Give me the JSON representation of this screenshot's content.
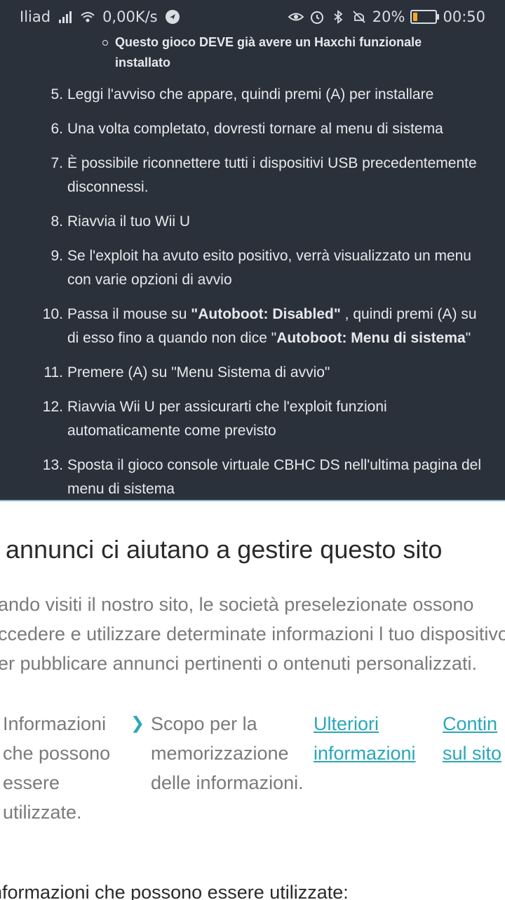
{
  "status_bar": {
    "carrier": "Iliad",
    "speed": "0,00K/s",
    "battery": "20%",
    "time": "00:50",
    "icons": [
      "signal-icon",
      "wifi-icon",
      "vpn-icon",
      "eye-icon",
      "alarm-icon",
      "bluetooth-icon",
      "mute-icon",
      "battery-icon"
    ]
  },
  "article": {
    "sub_bullet": "Questo gioco DEVE già avere un Haxchi funzionale installato",
    "steps": [
      {
        "num": "5.",
        "text": "Leggi l'avviso che appare, quindi premi (A) per installare"
      },
      {
        "num": "6.",
        "text": "Una volta completato, dovresti tornare al menu di sistema"
      },
      {
        "num": "7.",
        "text": "È possibile riconnettere tutti i dispositivi USB precedentemente disconnessi."
      },
      {
        "num": "8.",
        "text": "Riavvia il tuo Wii U"
      },
      {
        "num": "9.",
        "text": "Se l'exploit ha avuto esito positivo, verrà visualizzato un menu con varie opzioni di avvio"
      },
      {
        "num": "10.",
        "pre": "Passa il mouse su ",
        "b1": "\"Autoboot: Disabled\"",
        "mid": " , quindi premi (A) su di esso fino a quando non dice \"",
        "b2": "Autoboot: Menu di sistema",
        "post": "\""
      },
      {
        "num": "11.",
        "text": "Premere (A) su \"Menu Sistema di avvio\""
      },
      {
        "num": "12.",
        "text": "Riavvia Wii U per assicurarti che l'exploit funzioni automaticamente come previsto"
      },
      {
        "num": "13.",
        "text": "Sposta il gioco console virtuale CBHC DS nell'ultima pagina del menu di sistema"
      }
    ]
  },
  "consent": {
    "title": "I annunci ci aiutano a gestire questo sito",
    "description": "uando visiti il nostro sito, le società preselezionate ossono accedere e utilizzare determinate informazioni l tuo dispositivo per pubblicare annunci pertinenti o ontenuti personalizzati.",
    "col1": "Informazioni che possono essere utilizzate.",
    "col2": "Scopo per la memorizzazione delle informazioni.",
    "link_more": "Ulteriori informazioni",
    "link_continue": "Continua sul sito",
    "subheading": "nformazioni che possono essere utilizzate:"
  }
}
